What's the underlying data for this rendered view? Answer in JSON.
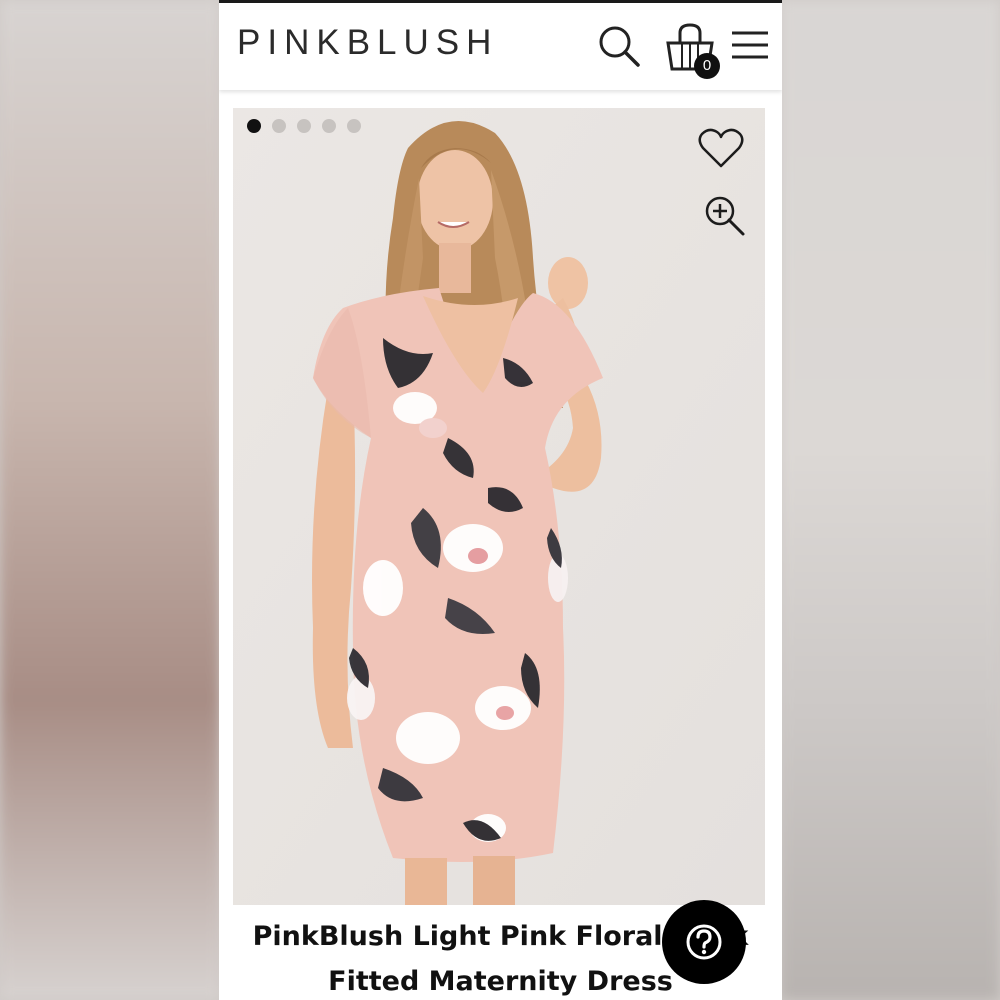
{
  "header": {
    "logo": "PINKBLUSH",
    "search_icon": "search-icon",
    "cart_icon": "shopping-bag-icon",
    "cart_count": "0",
    "menu_icon": "hamburger-menu-icon"
  },
  "gallery": {
    "slide_count": 5,
    "active_slide": 1,
    "wishlist_icon": "heart-icon",
    "zoom_icon": "zoom-in-icon"
  },
  "product": {
    "title_line1": "PinkBlush Light Pink Floral V",
    "title_line1_end": "k",
    "title_line2": "Fitted Maternity Dress"
  },
  "help": {
    "icon": "question-mark-icon"
  },
  "colors": {
    "accent": "#000000",
    "dress_pink": "#f0c4b8",
    "photo_bg": "#e9e6e4"
  }
}
